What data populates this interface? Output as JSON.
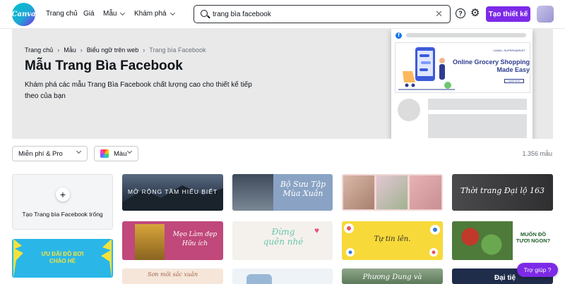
{
  "header": {
    "logo_text": "Canva",
    "nav": [
      "Trang chủ",
      "Giá",
      "Mẫu",
      "Khám phá"
    ],
    "search_value": "trang bìa facebook",
    "help_icon": "question-circle-icon",
    "settings_icon": "gear-icon",
    "cta_label": "Tạo thiết kế"
  },
  "hero": {
    "breadcrumb": [
      "Trang chủ",
      "Mẫu",
      "Biểu ngữ trên web",
      "Trang bìa Facebook"
    ],
    "title": "Mẫu Trang Bìa Facebook",
    "description": "Khám phá các mẫu Trang Bìa Facebook chất lượng cao cho thiết kế tiếp theo của bạn",
    "preview": {
      "small_label": "CAMILL SUPERMARKET",
      "headline": "Online Grocery Shopping Made Easy",
      "button": "SHOP NOW"
    }
  },
  "filters": {
    "price": "Miễn phí & Pro",
    "color": "Màu",
    "count": "1.356 mẫu"
  },
  "blank_template": {
    "label": "Tạo Trang bìa Facebook trống"
  },
  "templates": [
    {
      "text": "MỞ RỘNG TẦM HIỂU BIẾT",
      "bg": "#2c3a4d"
    },
    {
      "text": "Bộ Sưu Tập Mùa Xuân",
      "bg": "#8aa3c4"
    },
    {
      "text": "",
      "bg": "#f2d6d6"
    },
    {
      "text": "Thời trang Đại lộ 163",
      "bg": "#3b3b3d"
    },
    {
      "text": "Mẹo Làm đẹp Hữu ích",
      "bg": "#c0487a"
    },
    {
      "text": "Đừng quên nhé",
      "bg": "#f4f1ec"
    },
    {
      "text": "Tự tin lên.",
      "bg": "#f7d93a"
    },
    {
      "text": "MUỐN ĐỒ TƯƠI NGON?",
      "bg": "#3a6b3c"
    },
    {
      "text": "ƯU ĐÃI ĐỒ BƠI CHÀO HÈ",
      "bg": "#2ab7e8"
    },
    {
      "text": "Sơn môi sắc xuân",
      "bg": "#f6e6da"
    },
    {
      "text": "",
      "bg": "#eef3f8"
    },
    {
      "text": "Phương Dung và",
      "bg": "#5c7a5a"
    },
    {
      "text": "Đại tiệ",
      "bg": "#1f2c4a"
    }
  ],
  "help_button": "Trợ giúp ?"
}
